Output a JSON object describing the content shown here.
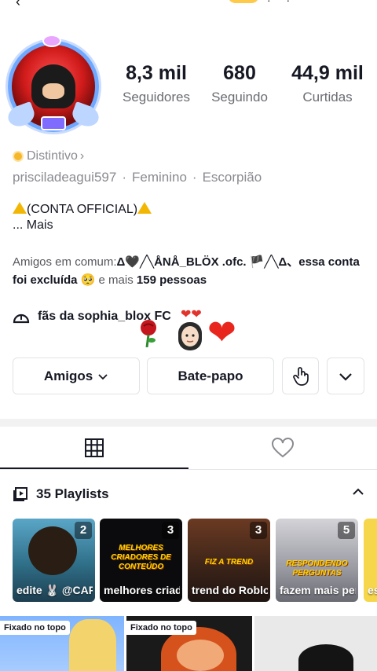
{
  "profile": {
    "stats": [
      {
        "value": "8,3 mil",
        "label": "Seguidores"
      },
      {
        "value": "680",
        "label": "Seguindo"
      },
      {
        "value": "44,9 mil",
        "label": "Curtidas"
      }
    ],
    "badge_label": "Distintivo",
    "username": "prisciladeagui597",
    "gender": "Feminino",
    "sign": "Escorpião",
    "bio_line1": "(CONTA OFFICIAL)",
    "bio_more": "...  Mais",
    "friends_prefix": "Amigos em comum:",
    "friends_name": "Δ🖤╱╲ÅNÅ_BLÖX .ofc. 🏴╱╲Δ、essa conta foi excluída 🥺",
    "friends_suffix_text": " e mais ",
    "friends_count": "159 pessoas",
    "group_name": "fãs da sophia_blox FC"
  },
  "actions": {
    "friends_button": "Amigos",
    "chat_button": "Bate-papo"
  },
  "tabs": {
    "grid_icon": "grid-icon",
    "liked_icon": "heart-outline-icon"
  },
  "playlists": {
    "title": "35 Playlists",
    "items": [
      {
        "count": "2",
        "title": "edite 🐰 @CARNEL_...",
        "tagline": ""
      },
      {
        "count": "3",
        "title": "melhores criadores d...",
        "tagline": "MELHORES CRIADORES DE CONTEÚDO"
      },
      {
        "count": "3",
        "title": "trend do Roblox💋 n...",
        "tagline": "FIZ A TREND"
      },
      {
        "count": "5",
        "title": "fazem mais perguntas #...",
        "tagline": "RESPONDENDO PERGUNTAS"
      },
      {
        "count": "",
        "title": "es #f",
        "tagline": ""
      }
    ]
  },
  "videos": {
    "pinned_label": "Fixado no topo"
  },
  "colors": {
    "text": "#161823",
    "muted": "#8a8b91",
    "warning": "#f2b705",
    "heart": "#e8261e"
  }
}
